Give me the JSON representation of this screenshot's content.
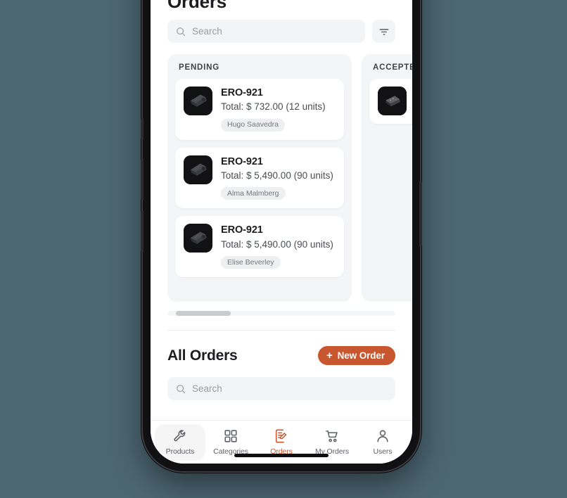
{
  "app": {
    "page_title": "Orders",
    "background_color": "#4c6672",
    "accent_color": "#c8562f"
  },
  "search": {
    "placeholder": "Search",
    "icon": "search-icon",
    "filter_icon": "filter-icon"
  },
  "board": {
    "columns": [
      {
        "title": "PENDING",
        "cards": [
          {
            "code": "ERO-921",
            "total": "Total: $ 732.00 (12 units)",
            "customer": "Hugo Saavedra",
            "thumb": "product-thumbnail"
          },
          {
            "code": "ERO-921",
            "total": "Total: $ 5,490.00 (90 units)",
            "customer": "Alma Malmberg",
            "thumb": "product-thumbnail"
          },
          {
            "code": "ERO-921",
            "total": "Total: $ 5,490.00 (90 units)",
            "customer": "Elise Beverley",
            "thumb": "product-thumbnail"
          }
        ]
      },
      {
        "title": "ACCEPTED",
        "cards": [
          {
            "code": "",
            "total": "",
            "customer": "",
            "thumb": "product-thumbnail"
          }
        ]
      }
    ]
  },
  "all_orders": {
    "title": "All Orders",
    "new_order_label": "New Order",
    "new_order_plus": "+",
    "search_placeholder": "Search"
  },
  "tabbar": {
    "items": [
      {
        "label": "Products",
        "icon": "wrench-icon",
        "active": false
      },
      {
        "label": "Categories",
        "icon": "grid-icon",
        "active": false
      },
      {
        "label": "Orders",
        "icon": "document-edit-icon",
        "active": true
      },
      {
        "label": "My Orders",
        "icon": "cart-icon",
        "active": false
      },
      {
        "label": "Users",
        "icon": "person-icon",
        "active": false
      }
    ]
  }
}
